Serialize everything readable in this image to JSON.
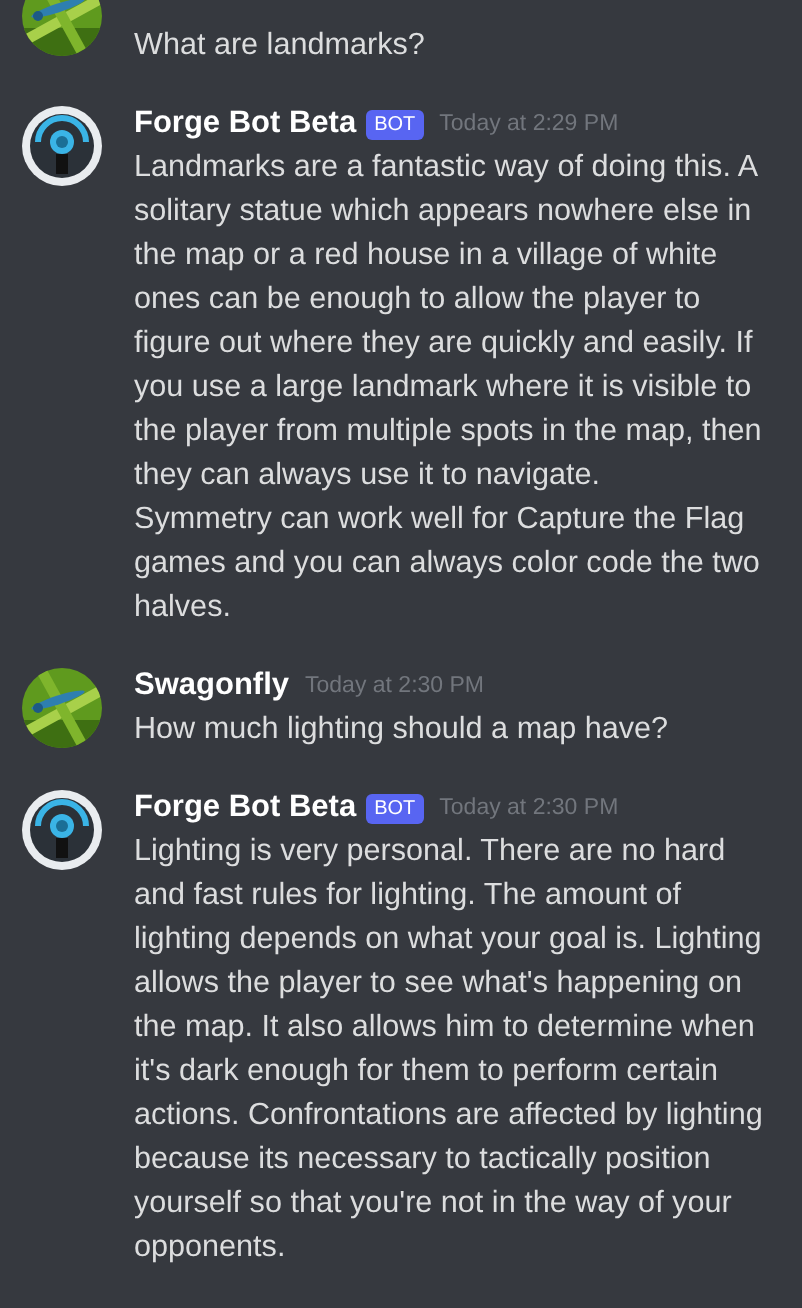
{
  "messages": [
    {
      "avatar": {
        "kind": "picture"
      },
      "paragraphs": [
        "What are landmarks?"
      ]
    },
    {
      "avatar": {
        "kind": "icon"
      },
      "author": "Forge Bot Beta",
      "badge": "BOT",
      "time": "Today at 2:29 PM",
      "paragraphs": [
        "Landmarks are a fantastic way of doing this. A solitary statue which appears nowhere else in the map or a red house in a village of white ones can be enough to allow the player to figure out where they are quickly and easily. If you use a large landmark where it is visible to the player from multiple spots in the map, then they can always use it to navigate.",
        "Symmetry can work well for Capture the Flag games and you can always color code the two halves."
      ]
    },
    {
      "avatar": {
        "kind": "picture"
      },
      "author": "Swagonfly",
      "time": "Today at 2:30 PM",
      "paragraphs": [
        "How much lighting should a map have?"
      ]
    },
    {
      "avatar": {
        "kind": "icon"
      },
      "author": "Forge Bot Beta",
      "badge": "BOT",
      "time": "Today at 2:30 PM",
      "paragraphs": [
        "Lighting is very personal. There are no hard and fast rules for lighting. The amount of lighting depends on what your goal is. Lighting allows the player to see what's happening on the map. It also allows him to determine when it's dark enough for them to perform certain actions. Confrontations are affected by lighting because its necessary to tactically position yourself so that you're not in the way of your opponents."
      ]
    }
  ]
}
